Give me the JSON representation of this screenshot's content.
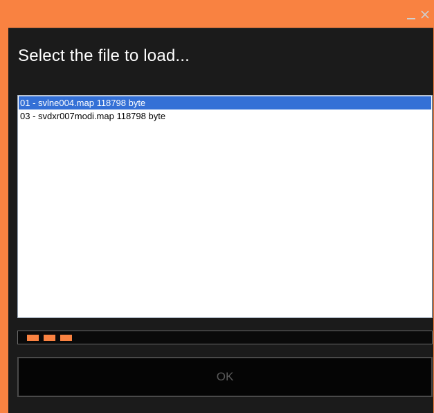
{
  "window": {
    "accent_color": "#f98241",
    "background_color": "#1b1b1b",
    "controls": {
      "minimize_icon": "minimize-icon",
      "close_icon": "close-icon"
    }
  },
  "dialog": {
    "heading": "Select the file to load...",
    "files": [
      {
        "label": "01 - svlne004.map 118798 byte",
        "selected": true
      },
      {
        "label": "03 - svdxr007modi.map 118798 byte",
        "selected": false
      }
    ],
    "selection_color": "#3470d6",
    "progress": {
      "active_blocks": 3
    },
    "ok_label": "OK"
  }
}
